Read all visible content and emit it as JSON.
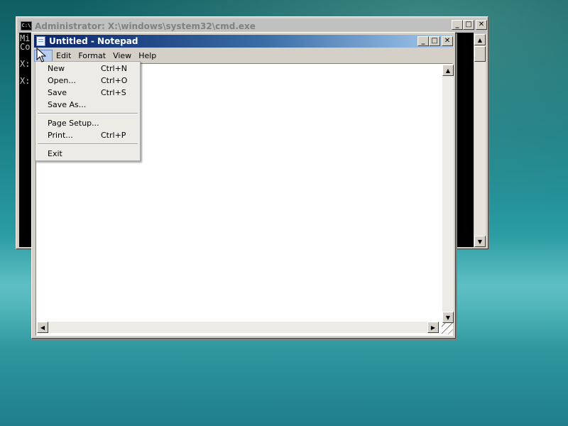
{
  "desktop": {
    "colors": {
      "wallpaper_top": "#0f5e62",
      "wallpaper_mid": "#3aa7ac"
    }
  },
  "cmd": {
    "title": "Administrator: X:\\windows\\system32\\cmd.exe",
    "icon": "cmd-prompt-icon",
    "console_lines": [
      "Mi",
      "Co",
      "",
      "X:",
      "",
      "X:"
    ],
    "buttons": {
      "minimize": "_",
      "maximize": "□",
      "close": "✕"
    }
  },
  "notepad": {
    "title": "Untitled - Notepad",
    "icon": "notepad-icon",
    "buttons": {
      "minimize": "_",
      "maximize": "□",
      "close": "✕"
    },
    "menu": [
      "File",
      "Edit",
      "Format",
      "View",
      "Help"
    ],
    "active_menu": "File",
    "colors": {
      "titlebar_start": "#0a246a",
      "titlebar_end": "#a6caf0",
      "menu_highlight": "#b9cdf0"
    }
  },
  "file_menu": {
    "items": [
      {
        "label": "New",
        "shortcut": "Ctrl+N"
      },
      {
        "label": "Open...",
        "shortcut": "Ctrl+O"
      },
      {
        "label": "Save",
        "shortcut": "Ctrl+S"
      },
      {
        "label": "Save As...",
        "shortcut": ""
      },
      {
        "label": "Page Setup...",
        "shortcut": ""
      },
      {
        "label": "Print...",
        "shortcut": "Ctrl+P"
      },
      {
        "label": "Exit",
        "shortcut": ""
      }
    ]
  }
}
